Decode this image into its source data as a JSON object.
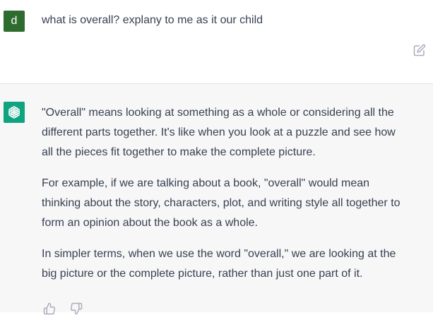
{
  "user": {
    "avatar_letter": "d",
    "avatar_color": "#2e6b2e",
    "message": "what is overall? explany to me as it our child",
    "edit_icon": "edit-icon"
  },
  "assistant": {
    "avatar_color": "#10a37f",
    "avatar_icon": "openai-logo-icon",
    "paragraphs": [
      [
        "\"Overall\" means looking at something as a whole or considering all the",
        "different parts together. It's like when you look at a puzzle and see how",
        "all the pieces fit together to make the complete picture."
      ],
      [
        "For example, if we are talking about a book, \"overall\" would mean",
        "thinking about the story, characters, plot, and writing style all together to",
        "form an opinion about the book as a whole."
      ],
      [
        "In simpler terms, when we use the word \"overall,\" we are looking at the",
        "big picture or the complete picture, rather than just one part of it."
      ]
    ],
    "feedback_icons": [
      "thumbs-up-icon",
      "thumbs-down-icon"
    ]
  }
}
